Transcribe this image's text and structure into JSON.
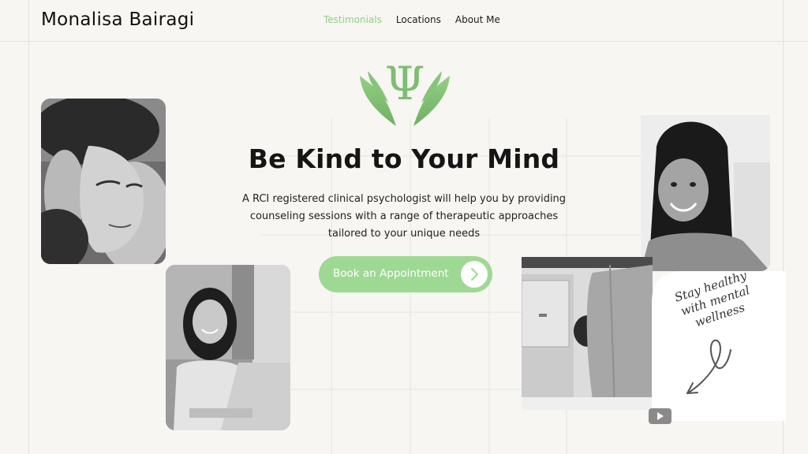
{
  "header": {
    "brand": "Monalisa Bairagi",
    "nav": [
      {
        "label": "Testimonials",
        "active": true
      },
      {
        "label": "Locations",
        "active": false
      },
      {
        "label": "About Me",
        "active": false
      }
    ]
  },
  "hero": {
    "logo_icon": "psi-hands-icon",
    "title": "Be Kind to Your Mind",
    "description": "A RCI registered clinical psychologist will help you by providing counseling sessions with a range of therapeutic approaches tailored to your unique needs",
    "cta_label": "Book an Appointment",
    "cta_icon": "chevron-right-icon"
  },
  "tagline": "Stay healthy with mental wellness",
  "video_icon": "youtube-play-icon",
  "colors": {
    "accent": "#9dd993",
    "accent_text": "#8fcf86",
    "background": "#f7f6f2"
  }
}
